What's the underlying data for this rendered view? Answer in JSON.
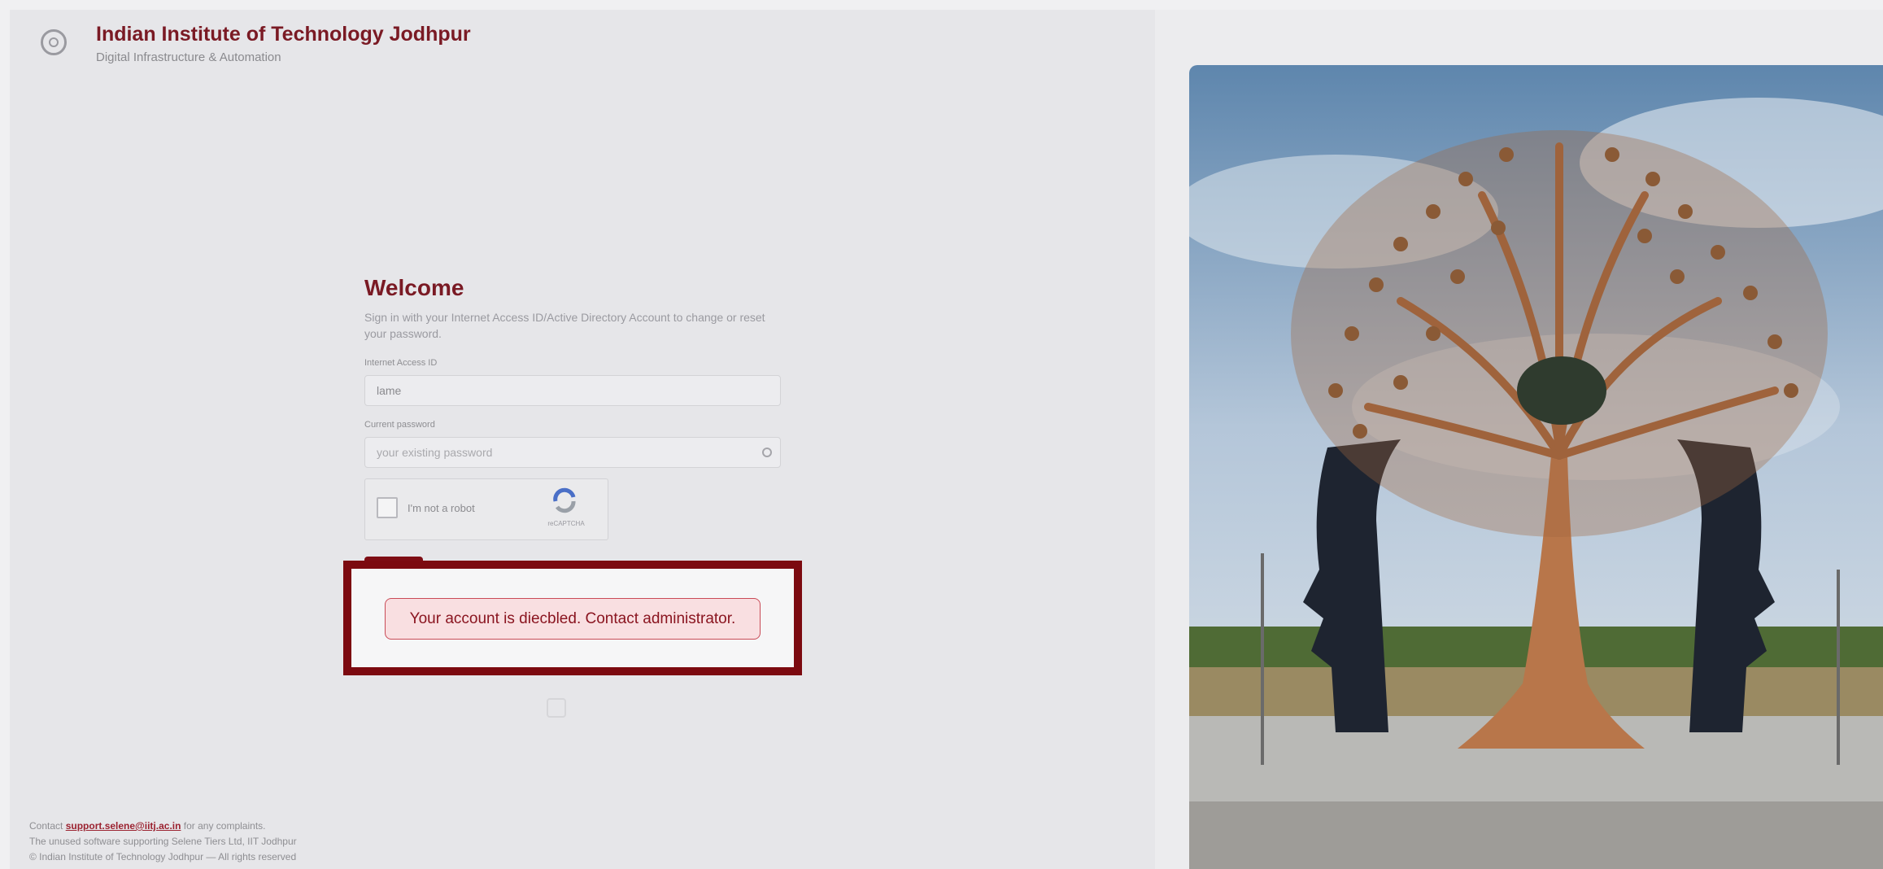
{
  "header": {
    "institute_name": "Indian Institute of Technology Jodhpur",
    "department": "Digital Infrastructure & Automation"
  },
  "form": {
    "title": "Welcome",
    "intro": "Sign in with your Internet Access ID/Active Directory Account to change or reset your password.",
    "username_label": "Internet Access ID",
    "username_value": "lame",
    "password_label": "Current password",
    "password_placeholder": "your existing password",
    "captcha_label": "I'm not a robot",
    "recaptcha_brand": "reCAPTCHA",
    "error_message": "Your account is diecbled. Contact administrator."
  },
  "footer": {
    "contact_prefix": "Contact",
    "contact_email": "support.selene@iitj.ac.in",
    "contact_suffix": "for any complaints.",
    "line2": "The unused software supporting Selene Tiers Ltd, IIT Jodhpur",
    "line3": "© Indian Institute of Technology Jodhpur — All rights reserved"
  },
  "icons": {
    "logo": "institute-emblem-icon",
    "eye": "eye-icon",
    "recaptcha": "recaptcha-icon"
  },
  "colors": {
    "brand": "#7a1a24",
    "highlight": "#7c0a10",
    "error_bg": "#f9dfe1"
  }
}
